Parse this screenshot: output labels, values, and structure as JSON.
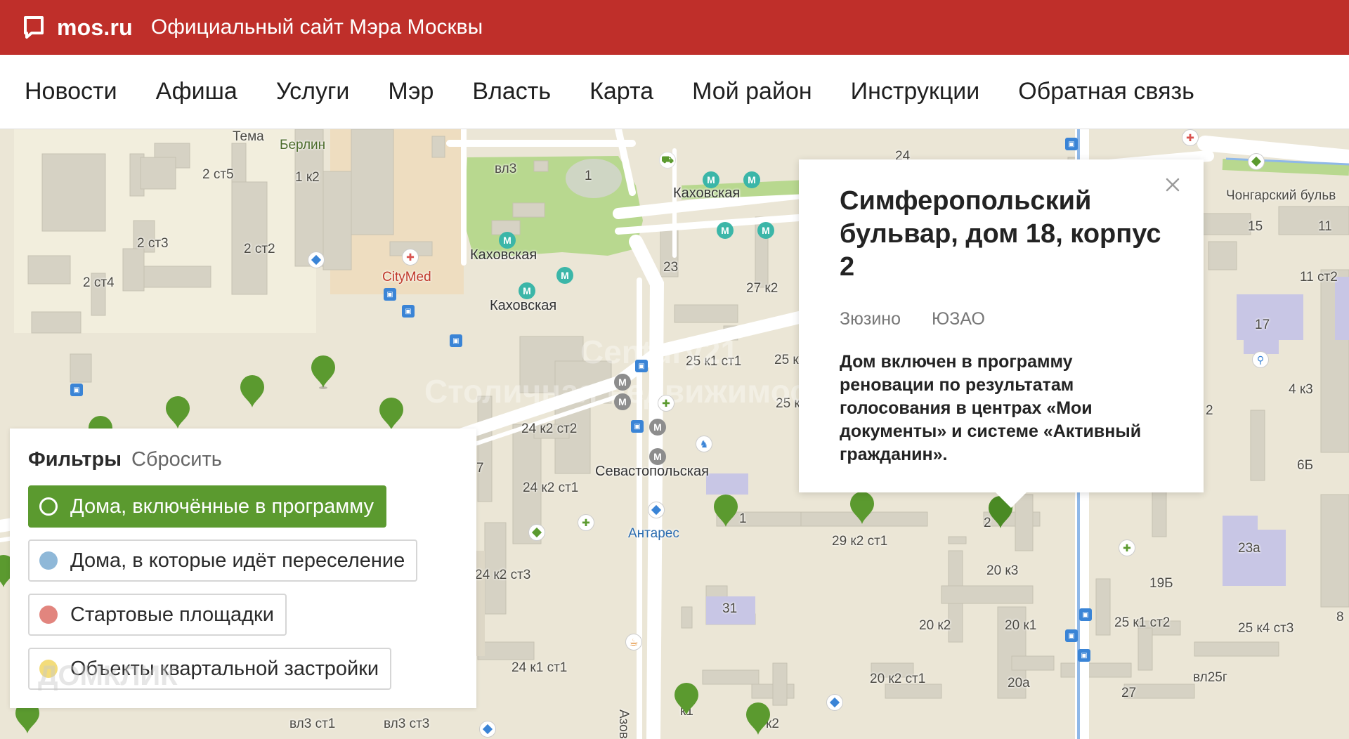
{
  "header": {
    "brand": "mos.ru",
    "site_title": "Официальный сайт Мэра Москвы"
  },
  "nav": {
    "items": [
      "Новости",
      "Афиша",
      "Услуги",
      "Мэр",
      "Власть",
      "Карта",
      "Мой район",
      "Инструкции",
      "Обратная связь"
    ]
  },
  "map": {
    "labels": {
      "tema": "Тема",
      "berlin": "Берлин",
      "s2st5": "2 ст5",
      "k1k2": "1 к2",
      "s2st3": "2 ст3",
      "s2st2": "2 ст2",
      "s2st4": "2 ст4",
      "citymed": "CityMed",
      "vl3": "вл3",
      "one": "1",
      "kakhovskaya_top": "Каховская",
      "kakhovskaya_mid": "Каховская",
      "kakhovskaya_low": "Каховская",
      "n23": "23",
      "n27k2": "27 к2",
      "n25k1st1": "25 к1 ст1",
      "n25k": "25 к",
      "n25k_b": "25 к",
      "n24k2st2": "24 к2 ст2",
      "n24k2st1": "24 к2 ст1",
      "n24k2st3": "24 к2 ст3",
      "n24k1st1": "24 к1 ст1",
      "sevastopolskaya": "Севастопольская",
      "antares": "Антарес",
      "n29k2st1": "29 к2 ст1",
      "n20k3": "20 к3",
      "n20k2": "20 к2",
      "n20k1": "20 к1",
      "n20k2st1": "20 к2 ст1",
      "n20a": "20а",
      "n31": "31",
      "n24": "24",
      "chongarsky": "Чонгарский бульв",
      "n15": "15",
      "n11": "11",
      "n11st2": "11 ст2",
      "n17": "17",
      "n4k3": "4 к3",
      "n2": "2",
      "n6b": "6Б",
      "n23a": "23а",
      "n19b": "19Б",
      "n25k1st2": "25 к1 ст2",
      "n25k4st3": "25 к4 ст3",
      "vl25g": "вл25г",
      "n27": "27",
      "azov": "Азов",
      "vl3st1": "вл3 ст1",
      "vl3st3": "вл3 ст3",
      "k1": "к1",
      "k2_pin": "2",
      "k2_pin_b": "к2",
      "n8": "8",
      "n1_edge": "1",
      "n7": "7"
    },
    "watermark_1": "Century21",
    "watermark_2": "Столичная недвижимость",
    "watermark_3": "ДОМКЛИК"
  },
  "popup": {
    "title": "Симферопольский бульвар, дом 18, корпус 2",
    "district": "Зюзино",
    "okrug": "ЮЗАО",
    "description": "Дом включен в программу реновации по результатам голосования в центрах «Мои документы» и системе «Активный гражданин»."
  },
  "filters": {
    "title": "Фильтры",
    "reset": "Сбросить",
    "items": [
      {
        "label": "Дома, включённые в программу",
        "color": "#5b9a2f",
        "active": true
      },
      {
        "label": "Дома, в которые идёт переселение",
        "color": "#8fb8d8",
        "active": false
      },
      {
        "label": "Стартовые площадки",
        "color": "#e2857e",
        "active": false
      },
      {
        "label": "Объекты квартальной застройки",
        "color": "#f3dc7a",
        "active": false
      }
    ]
  },
  "colors": {
    "header_red": "#bf2f2a",
    "pin_green": "#5b9a2f",
    "park_green": "#b8d88f",
    "metro_teal": "#3bb6a8"
  }
}
